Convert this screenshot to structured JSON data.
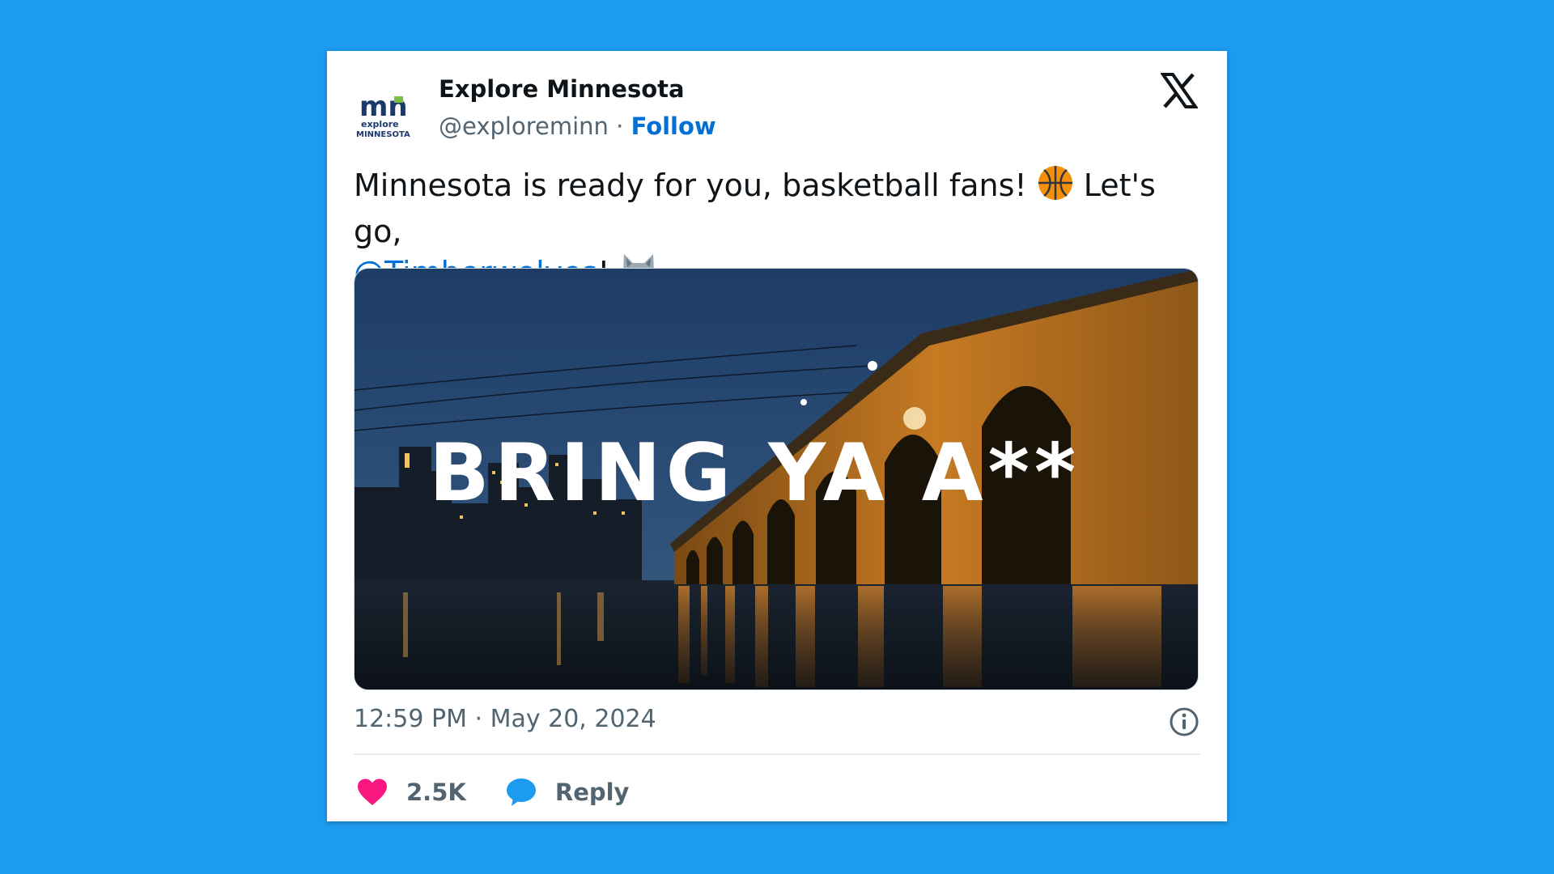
{
  "author": {
    "display_name": "Explore Minnesota",
    "handle": "@exploreminn",
    "separator": " · ",
    "follow_label": "Follow",
    "avatar_logo_text": "mn",
    "avatar_sub_line1": "explore",
    "avatar_sub_line2": "MINNESOTA"
  },
  "tweet": {
    "text_part1": "Minnesota is ready for you, basketball fans! ",
    "text_part2": " Let's go, ",
    "mention": "@Timberwolves",
    "text_part3": "! ",
    "emoji_1": "basketball-emoji",
    "emoji_2": "wolf-emoji"
  },
  "media": {
    "overlay_text": "BRING YA A**"
  },
  "meta": {
    "time": "12:59 PM",
    "separator": " · ",
    "date": "May 20, 2024"
  },
  "actions": {
    "likes_count": "2.5K",
    "reply_label": "Reply"
  },
  "colors": {
    "background": "#1d9bf0",
    "link": "#006fd6",
    "heart": "#f91880",
    "reply_bubble": "#1d9bf0",
    "muted_text": "#536471"
  },
  "icons": [
    "x-logo-icon",
    "info-icon",
    "heart-icon",
    "reply-bubble-icon"
  ]
}
